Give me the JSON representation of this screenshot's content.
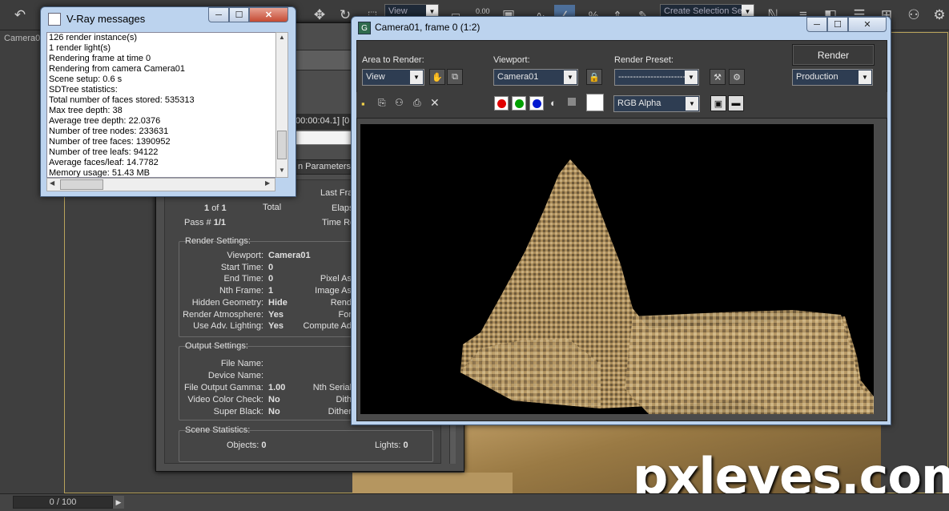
{
  "viewport": {
    "label": "Camera0",
    "frame_counter": "0 / 100"
  },
  "toolbar": {
    "view_dropdown": "View",
    "snap_value": "0.00",
    "selection_set": "Create Selection Se"
  },
  "watermark": "pxleyes.com",
  "vray_messages": {
    "title": "V-Ray messages",
    "log": [
      "126 render instance(s)",
      "1 render light(s)",
      "Rendering frame at time 0",
      "Rendering from camera Camera01",
      "Scene setup: 0.6 s",
      "SDTree statistics:",
      "Total number of faces stored: 535313",
      "Max tree depth: 38",
      "Average tree depth: 22.0376",
      "Number of tree nodes: 233631",
      "Number of tree faces: 1390952",
      "Number of tree leafs: 94122",
      "Average faces/leaf: 14.7782",
      "Memory usage: 51.43 MB"
    ]
  },
  "progress": {
    "elapsed_fragment": "00:00:04.1] [0",
    "params_fragment": "n Parameters",
    "last_frame": "Last Fra",
    "frame_of": "1",
    "frame_of_sep": "of",
    "frame_total": "1",
    "total_label": "Total",
    "elapsed_label": "Elaps",
    "pass_label": "Pass #",
    "pass_value": "1/1",
    "time_remaining": "Time Re",
    "render_settings": {
      "title": "Render Settings:",
      "rows": [
        {
          "label": "Viewport:",
          "value": "Camera01",
          "right": ""
        },
        {
          "label": "Start Time:",
          "value": "0",
          "right": ""
        },
        {
          "label": "End Time:",
          "value": "0",
          "right": "Pixel As"
        },
        {
          "label": "Nth Frame:",
          "value": "1",
          "right": "Image As"
        },
        {
          "label": "Hidden Geometry:",
          "value": "Hide",
          "right": "Rend"
        },
        {
          "label": "Render Atmosphere:",
          "value": "Yes",
          "right": "For"
        },
        {
          "label": "Use Adv. Lighting:",
          "value": "Yes",
          "right": "Compute Ad"
        }
      ]
    },
    "output_settings": {
      "title": "Output Settings:",
      "rows": [
        {
          "label": "File Name:",
          "value": "",
          "right": ""
        },
        {
          "label": "Device Name:",
          "value": "",
          "right": ""
        },
        {
          "label": "File Output Gamma:",
          "value": "1.00",
          "right": "Nth Serial"
        },
        {
          "label": "Video Color Check:",
          "value": "No",
          "right": "Dith"
        },
        {
          "label": "Super Black:",
          "value": "No",
          "right": "Dither"
        }
      ]
    },
    "scene_statistics": {
      "title": "Scene Statistics:",
      "objects_label": "Objects:",
      "objects_value": "0",
      "lights_label": "Lights:",
      "lights_value": "0"
    }
  },
  "render_window": {
    "title": "Camera01, frame 0 (1:2)",
    "area_label": "Area to Render:",
    "area_value": "View",
    "viewport_label": "Viewport:",
    "viewport_value": "Camera01",
    "preset_label": "Render Preset:",
    "preset_value": "-------------------------",
    "render_button": "Render",
    "production_value": "Production",
    "channel_value": "RGB Alpha",
    "colors": {
      "red": "#e00000",
      "green": "#00a000",
      "blue": "#0018d0"
    }
  }
}
